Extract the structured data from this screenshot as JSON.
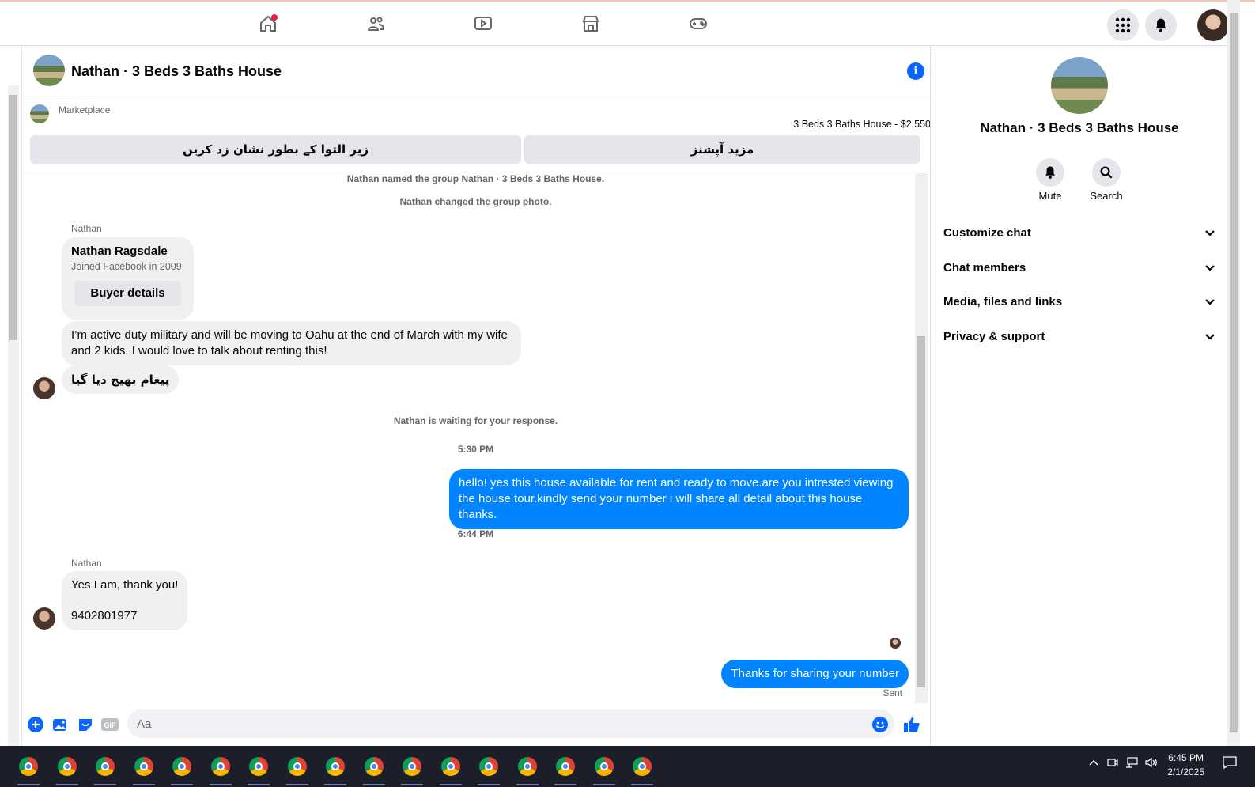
{
  "top_nav": {
    "items": [
      "home-icon",
      "friends-icon",
      "watch-icon",
      "marketplace-icon",
      "gaming-icon"
    ],
    "right": [
      "menu-grid-icon",
      "notifications-icon",
      "profile-avatar"
    ]
  },
  "chat": {
    "title": "Nathan · 3 Beds 3 Baths House",
    "marketplace_label": "Marketplace",
    "listing": "3 Beds 3 Baths House - $2,550",
    "btn_pending": "زیر التوا کے بطور نشان زد کریں",
    "btn_more": "مزید آپشنز",
    "system_1": "Nathan named the group Nathan · 3 Beds 3 Baths House.",
    "system_2": "Nathan changed the group photo.",
    "sender_1": "Nathan",
    "card_name": "Nathan Ragsdale",
    "card_joined": "Joined Facebook in 2009",
    "card_button": "Buyer details",
    "msg_1": "I’m active duty military and will be moving to Oahu at the end of March with my wife and 2 kids. I would love to talk about renting this!",
    "msg_2": "پیغام بھیج دیا گیا",
    "waiting": "Nathan is waiting for your response.",
    "time_1": "5:30 PM",
    "msg_out_1": "hello! yes this house available for rent and ready to move.are you intrested viewing the house tour.kindly send your number i will share all detail about this house thanks.",
    "time_2": "6:44 PM",
    "sender_2": "Nathan",
    "msg_3a": "Yes I am, thank you!",
    "msg_3b": "9402801977",
    "msg_out_2": "Thanks for sharing your number",
    "sent_status": "Sent",
    "composer_placeholder": "Aa"
  },
  "right_panel": {
    "title": "Nathan · 3 Beds 3 Baths House",
    "mute": "Mute",
    "search": "Search",
    "rows": [
      "Customize chat",
      "Chat members",
      "Media, files and links",
      "Privacy & support"
    ]
  },
  "taskbar": {
    "time": "6:45 PM",
    "date": "2/1/2025"
  },
  "colors": {
    "accent": "#0084ff",
    "bubble_in": "#f0f0f0",
    "button_grey": "#e4e6eb",
    "taskbar": "#1c1f2a"
  }
}
